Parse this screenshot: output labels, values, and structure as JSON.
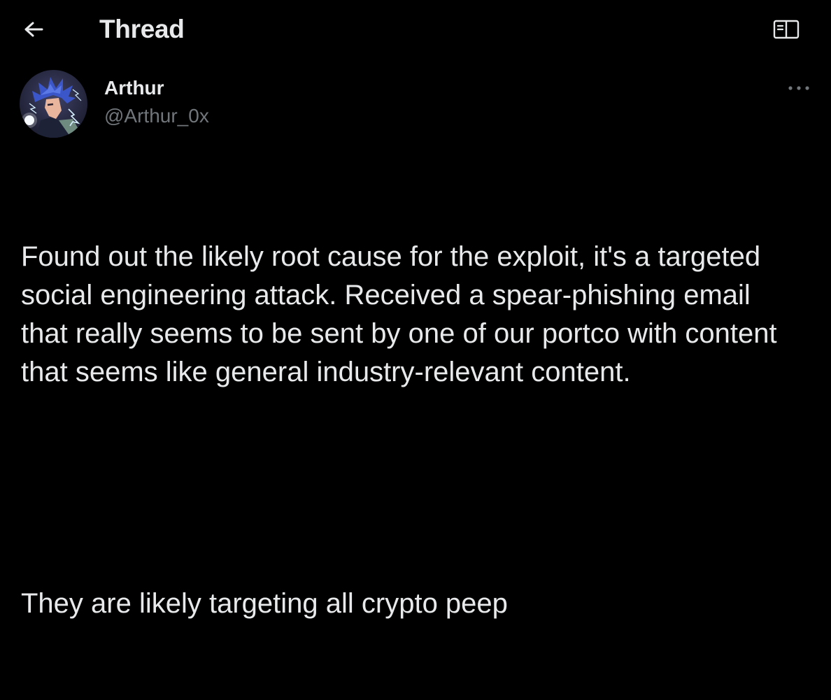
{
  "header": {
    "title": "Thread",
    "back_icon": "arrow-left-icon",
    "reader_icon": "open-book-icon"
  },
  "tweet": {
    "author_name": "Arthur",
    "author_handle": "@Arthur_0x",
    "more_icon": "more-horizontal-icon",
    "avatar": "avatar-illustration",
    "paragraphs": [
      "Found out the likely root cause for the exploit, it's a targeted social engineering attack. Received a spear-phishing email that really seems to be sent by one of our portco with content that seems like general industry-relevant content.",
      "They are likely targeting all crypto peep"
    ]
  },
  "colors": {
    "background": "#000000",
    "text_primary": "#e7e9ea",
    "text_secondary": "#71767b"
  }
}
